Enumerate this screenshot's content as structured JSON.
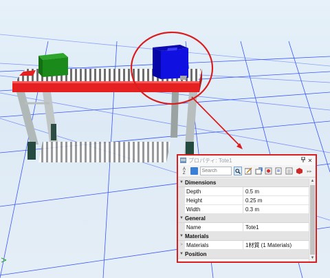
{
  "scene": {
    "colors": {
      "highlight": "#d81e1e",
      "tote": "#1010e0",
      "box": "#1a8a1a",
      "belt_red": "#e52020"
    }
  },
  "panel": {
    "title": "プロパティ: Tote1",
    "pin_icon": "pin-icon",
    "close_label": "✕",
    "search_placeholder": "Search",
    "categories": [
      {
        "label": "Dimensions",
        "rows": [
          {
            "name": "Depth",
            "value": "0.5 m"
          },
          {
            "name": "Height",
            "value": "0.25 m"
          },
          {
            "name": "Width",
            "value": "0.3 m"
          }
        ]
      },
      {
        "label": "General",
        "rows": [
          {
            "name": "Name",
            "value": "Tote1"
          }
        ]
      },
      {
        "label": "Materials",
        "rows": [
          {
            "name": "Materials",
            "value": "1材質 (1 Materials)"
          }
        ]
      },
      {
        "label": "Position",
        "rows": []
      }
    ]
  }
}
